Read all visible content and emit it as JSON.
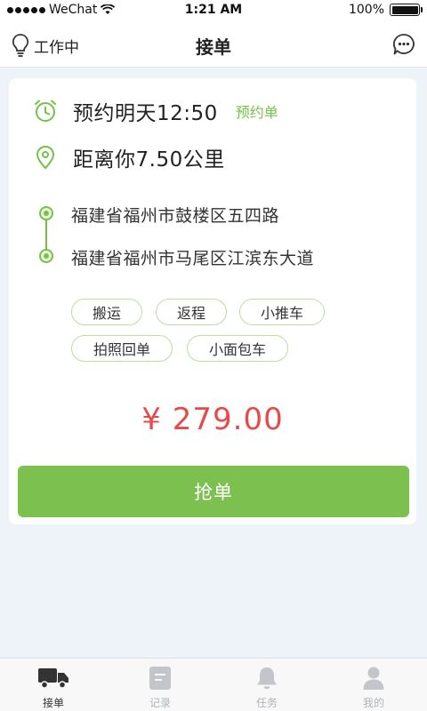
{
  "status_bar": {
    "carrier": "WeChat",
    "time": "1:21 AM",
    "battery": "100%",
    "battery_level": 1.0
  },
  "nav": {
    "left_label": "工作中",
    "title": "接单",
    "left_icon": "lightbulb-icon",
    "right_icon": "chat-bubble-icon"
  },
  "order": {
    "time_text": "预约明天12:50",
    "appointment_tag": "预约单",
    "distance_text": "距离你7.50公里",
    "from_address": "福建省福州市鼓楼区五四路",
    "to_address": "福建省福州市马尾区江滨东大道",
    "tags": [
      "搬运",
      "返程",
      "小推车",
      "拍照回单",
      "小面包车"
    ],
    "price": "¥ 279.00",
    "grab_button": "抢单"
  },
  "tabs": [
    {
      "label": "接单",
      "icon": "truck-icon",
      "active": true
    },
    {
      "label": "记录",
      "icon": "document-icon",
      "active": false
    },
    {
      "label": "任务",
      "icon": "bell-icon",
      "active": false
    },
    {
      "label": "我的",
      "icon": "person-icon",
      "active": false
    }
  ],
  "colors": {
    "accent": "#76c14a",
    "price": "#e84a4a",
    "background": "#eef2f9"
  }
}
